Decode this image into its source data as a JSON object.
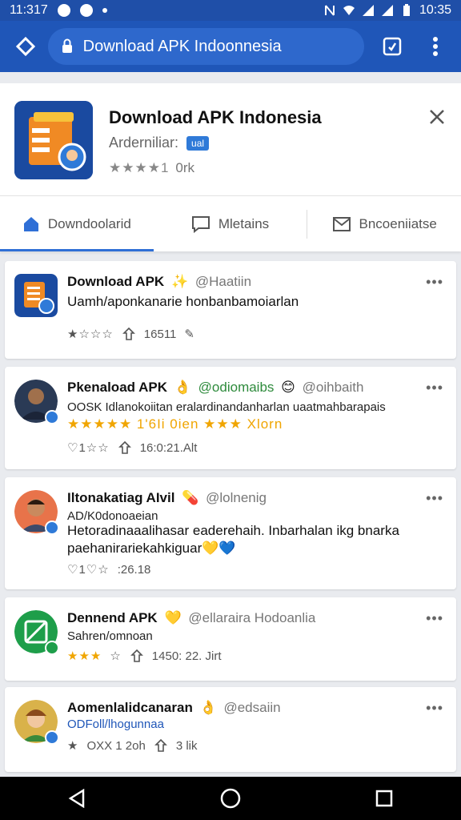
{
  "status_bar": {
    "time_left": "11:317",
    "time_right": "10:35"
  },
  "browser": {
    "url": "Download APK Indoonnesia"
  },
  "app": {
    "title": "Download APK Indonesia",
    "subtitle": "Arderniliar:",
    "badge": "ual",
    "rating_stars": "★★★★1",
    "rating_text": "0rk"
  },
  "tabs": [
    {
      "label": "Downdoolarid",
      "icon": "home-icon"
    },
    {
      "label": "Mletains",
      "icon": "chat-icon"
    },
    {
      "label": "Bncoeniiatse",
      "icon": "mail-icon"
    }
  ],
  "posts": [
    {
      "name": "Download APK",
      "handle": "@Haatiin",
      "line1": "Uamh/aponkanarie honbanbamoiarlan",
      "stats": "16511",
      "stars": "★☆☆☆"
    },
    {
      "name": "Pkenaload APK",
      "handle_green": "@odiomaibs",
      "handle": "@oihbaith",
      "line1": "OOSK Idlanokoiitan eralardinandanharlan uaatmahbarapais",
      "rating_line": "★★★★★ 1'6Ii 0ien ★★★ Xlorn",
      "stats": "16:0:21.Alt"
    },
    {
      "name": "Iltonakatiag AIvil",
      "handle": "@lolnenig",
      "line1": "AD/K0donoaeian",
      "line2": "Hetoradinaaalihasar eaderehaih. Inbarhalan ikg bnarka",
      "line3": "paehanirariekahkiguar",
      "stats": ":26.18"
    },
    {
      "name": "Dennend APK",
      "handle": "@ellaraira Hodoanlia",
      "line1": "Sahren/omnoan",
      "stars": "★★★",
      "stats": "1450: 22. Jirt"
    },
    {
      "name": "Aomenlalidcanaran",
      "handle": "@edsaiin",
      "line1": "ODFoll/lhogunnaa",
      "stats": "OXX 1 2oh",
      "stats2": "3 lik"
    }
  ],
  "colors": {
    "statusbar": "#1f4fa8",
    "toolbar": "#1f56b8",
    "accent": "#2f6fd6",
    "star": "#f0a500"
  }
}
